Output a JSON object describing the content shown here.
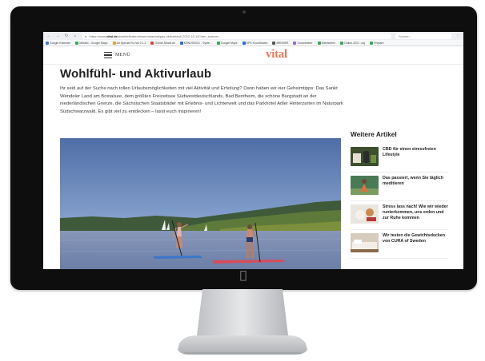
{
  "browser": {
    "url_prefix": "https://www.",
    "url_domain": "vital.de",
    "url_path": "/wohlbefinden/reisen/urlaubstipps-aktivurlaub-2022-10-18?utm_source=...",
    "search_placeholder": "Suchen",
    "bookmarks": [
      {
        "label": "Google Kalender",
        "color": "#4a7bd8"
      },
      {
        "label": "Metallo - Google Maps",
        "color": "#3aa757"
      },
      {
        "label": "Ad Special Ro hdr 2.1.2",
        "color": "#e8a23a"
      },
      {
        "label": "Online-Shadt.de",
        "color": "#d24a3a"
      },
      {
        "label": "KRNOS2021 - Syste...",
        "color": "#2f6dc8"
      },
      {
        "label": "Google Maps",
        "color": "#3aa757"
      },
      {
        "label": "SPS Koordinaten",
        "color": "#2f6dc8"
      },
      {
        "label": "BREMER",
        "color": "#555555"
      },
      {
        "label": "Crowdmeter",
        "color": "#9a6bd1"
      },
      {
        "label": "Wiedsehen",
        "color": "#3aa757"
      },
      {
        "label": "Online-2021 .org",
        "color": "#3aa757"
      },
      {
        "label": "Prepare",
        "color": "#3aa757"
      }
    ]
  },
  "header": {
    "menu_label": "MENÜ",
    "logo_text": "vital",
    "logo_color": "#e47a5c"
  },
  "article": {
    "title": "Wohlfühl- und Aktivurlaub",
    "intro": "Ihr seid auf der Suche nach tollen Urlaubsmöglichkeiten mit viel Aktivität und Erholung? Dann haben wir vier Geheimtipps: Das Sankt Wendeler Land am Bostalsee, dem größten Freizeitsee Südwestdeutschlands, Bad Bentheim, die schöne Burgstadt an der niederländischen Grenze, die Sächsischen Staatsbäder mit Erlebnis- und Lichterwelt und das Parkhotel Adler Hinterzarten im Naturpark Südschwarzwald. Es gibt viel zu entdecken – lasst euch inspirieren!"
  },
  "sidebar": {
    "title": "Weitere Artikel",
    "items": [
      {
        "title": "CBD für einen stressfreien Lifestyle",
        "thumb": "cbd-bottle"
      },
      {
        "title": "Das passiert, wenn Sie täglich meditieren",
        "thumb": "meditation"
      },
      {
        "title": "Stress lass nach! Wie wir wieder runterkommen, uns erden und zur Ruhe kommen",
        "thumb": "breakfast"
      },
      {
        "title": "Wir testen die Gewichtsdecken von CURA of Sweden",
        "thumb": "bed"
      }
    ]
  },
  "colors": {
    "accent": "#e47a5c",
    "monitor": "#0e0e0f",
    "text": "#1f1f1f"
  }
}
